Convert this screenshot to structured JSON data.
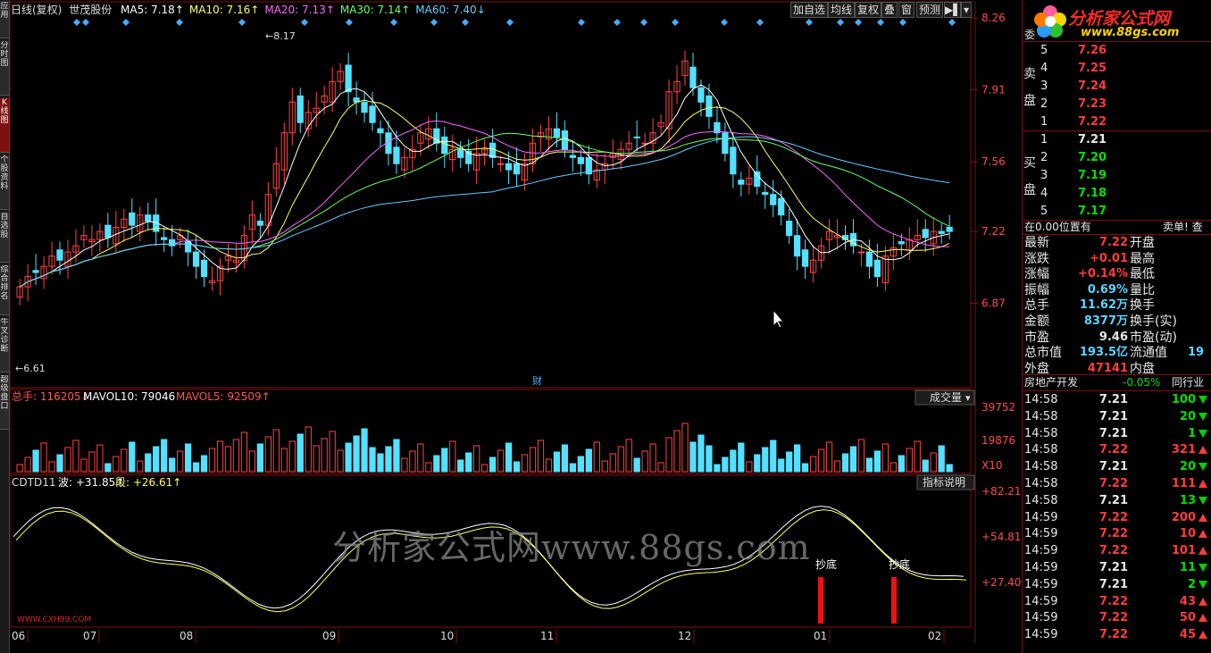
{
  "left_tabs": [
    "应用",
    "分时图",
    "K线图",
    "个股资料",
    "自选股",
    "综合排名",
    "牛叉诊断",
    "超级盘口"
  ],
  "header": {
    "period": "日线(复权)",
    "stock": "世茂股份",
    "ma": [
      {
        "label": "MA5: 7.18",
        "color": "#ffffff"
      },
      {
        "label": "MA10: 7.16",
        "color": "#ffff66"
      },
      {
        "label": "MA20: 7.13",
        "color": "#ff66ff"
      },
      {
        "label": "MA30: 7.14",
        "color": "#66ff66"
      },
      {
        "label": "MA60: 7.40",
        "color": "#66ccff"
      }
    ]
  },
  "toolbar": [
    "加自选",
    "均线",
    "复权",
    "叠",
    "窗",
    "预测"
  ],
  "price_axis": [
    "8.26",
    "7.91",
    "7.56",
    "7.22",
    "6.87"
  ],
  "high_label": "8.17",
  "low_label": "6.61",
  "cai_marker": "财",
  "volume": {
    "title": "总手: 116205",
    "mavol10": "MAVOL10: 79046",
    "mavol5": "MAVOL5: 92509",
    "selector": "成交量",
    "axis": [
      "39752",
      "19876",
      "X10"
    ]
  },
  "indicator": {
    "name": "CDTD11",
    "bo": "波: +31.85",
    "duan": "段: +26.61",
    "btn": "指标说明",
    "axis": [
      "+82.21",
      "+54.81",
      "+27.40"
    ],
    "signals": [
      "抄底",
      "抄底"
    ],
    "site": "WWW.CXH99.COM"
  },
  "months": [
    "06",
    "07",
    "08",
    "09",
    "10",
    "11",
    "12",
    "01",
    "02"
  ],
  "watermark": "分析家公式网www.88gs.com",
  "logo": {
    "name": "分析家公式网",
    "url": "www.88gs.com"
  },
  "orderbook": {
    "sell_label": [
      "卖",
      "盘"
    ],
    "buy_label": [
      "买",
      "盘"
    ],
    "corner": "委",
    "sell": [
      {
        "lvl": "5",
        "price": "7.26"
      },
      {
        "lvl": "4",
        "price": "7.25"
      },
      {
        "lvl": "3",
        "price": "7.24"
      },
      {
        "lvl": "2",
        "price": "7.23"
      },
      {
        "lvl": "1",
        "price": "7.22"
      }
    ],
    "buy": [
      {
        "lvl": "1",
        "price": "7.21"
      },
      {
        "lvl": "2",
        "price": "7.20"
      },
      {
        "lvl": "3",
        "price": "7.19"
      },
      {
        "lvl": "4",
        "price": "7.18"
      },
      {
        "lvl": "5",
        "price": "7.17"
      }
    ]
  },
  "pos_text": "在0.00位置有",
  "pos_link": "卖单! 查",
  "quote": [
    {
      "l": "最新",
      "v": "7.22",
      "vc": "red",
      "r": "开盘",
      "rv": ""
    },
    {
      "l": "涨跌",
      "v": "+0.01",
      "vc": "red",
      "r": "最高",
      "rv": ""
    },
    {
      "l": "涨幅",
      "v": "+0.14%",
      "vc": "red",
      "r": "最低",
      "rv": ""
    },
    {
      "l": "振幅",
      "v": "0.69%",
      "vc": "cyan",
      "r": "量比",
      "rv": ""
    },
    {
      "l": "总手",
      "v": "11.62万",
      "vc": "cyan",
      "r": "换手",
      "rv": ""
    },
    {
      "l": "金额",
      "v": "8377万",
      "vc": "cyan",
      "r": "换手(实)",
      "rv": ""
    },
    {
      "l": "市盈",
      "v": "9.46",
      "vc": "wht",
      "r": "市盈(动)",
      "rv": ""
    },
    {
      "l": "总市值",
      "v": "193.5亿",
      "vc": "cyan",
      "r": "流通值",
      "rv": "19"
    },
    {
      "l": "外盘",
      "v": "47141",
      "vc": "red",
      "r": "内盘",
      "rv": ""
    }
  ],
  "sector": {
    "name": "房地产开发",
    "chg": "-0.05%",
    "peers": "同行业"
  },
  "ticks": [
    {
      "t": "14:58",
      "p": "7.21",
      "pc": "wht",
      "v": "100",
      "d": "dn"
    },
    {
      "t": "14:58",
      "p": "7.21",
      "pc": "wht",
      "v": "20",
      "d": "dn"
    },
    {
      "t": "14:58",
      "p": "7.21",
      "pc": "wht",
      "v": "1",
      "d": "dn"
    },
    {
      "t": "14:58",
      "p": "7.22",
      "pc": "red",
      "v": "321",
      "d": "up"
    },
    {
      "t": "14:58",
      "p": "7.21",
      "pc": "wht",
      "v": "20",
      "d": "dn"
    },
    {
      "t": "14:58",
      "p": "7.22",
      "pc": "red",
      "v": "111",
      "d": "up"
    },
    {
      "t": "14:58",
      "p": "7.21",
      "pc": "wht",
      "v": "13",
      "d": "dn"
    },
    {
      "t": "14:59",
      "p": "7.22",
      "pc": "red",
      "v": "200",
      "d": "up"
    },
    {
      "t": "14:59",
      "p": "7.22",
      "pc": "red",
      "v": "10",
      "d": "up"
    },
    {
      "t": "14:59",
      "p": "7.22",
      "pc": "red",
      "v": "101",
      "d": "up"
    },
    {
      "t": "14:59",
      "p": "7.21",
      "pc": "wht",
      "v": "11",
      "d": "dn"
    },
    {
      "t": "14:59",
      "p": "7.21",
      "pc": "wht",
      "v": "2",
      "d": "dn"
    },
    {
      "t": "14:59",
      "p": "7.22",
      "pc": "red",
      "v": "43",
      "d": "up"
    },
    {
      "t": "14:59",
      "p": "7.22",
      "pc": "red",
      "v": "50",
      "d": "up"
    },
    {
      "t": "14:59",
      "p": "7.22",
      "pc": "red",
      "v": "45",
      "d": "up"
    }
  ],
  "chart_data": {
    "type": "candlestick",
    "price_range": [
      6.52,
      8.26
    ],
    "months": [
      "06",
      "07",
      "08",
      "09",
      "10",
      "11",
      "12",
      "01",
      "02"
    ],
    "closes": [
      6.95,
      7.0,
      7.02,
      7.05,
      7.1,
      7.08,
      7.12,
      7.15,
      7.2,
      7.18,
      7.22,
      7.19,
      7.24,
      7.28,
      7.25,
      7.3,
      7.27,
      7.22,
      7.18,
      7.15,
      7.2,
      7.12,
      7.05,
      7.0,
      6.98,
      7.05,
      7.1,
      7.08,
      7.2,
      7.3,
      7.25,
      7.4,
      7.55,
      7.7,
      7.85,
      7.75,
      7.8,
      7.82,
      7.88,
      7.95,
      8.0,
      7.9,
      7.85,
      7.8,
      7.75,
      7.7,
      7.6,
      7.55,
      7.58,
      7.62,
      7.7,
      7.72,
      7.65,
      7.6,
      7.62,
      7.58,
      7.55,
      7.6,
      7.62,
      7.58,
      7.55,
      7.52,
      7.5,
      7.55,
      7.65,
      7.7,
      7.72,
      7.68,
      7.62,
      7.58,
      7.55,
      7.5,
      7.52,
      7.55,
      7.6,
      7.62,
      7.65,
      7.68,
      7.65,
      7.7,
      7.75,
      7.9,
      7.95,
      8.05,
      7.92,
      7.85,
      7.78,
      7.7,
      7.6,
      7.5,
      7.45,
      7.48,
      7.44,
      7.4,
      7.35,
      7.3,
      7.2,
      7.1,
      7.05,
      7.08,
      7.15,
      7.22,
      7.2,
      7.18,
      7.15,
      7.12,
      7.05,
      7.0,
      7.1,
      7.14,
      7.16,
      7.18,
      7.2,
      7.19,
      7.22,
      7.21,
      7.22
    ],
    "ma60_end": 7.4,
    "indicator_range": [
      0,
      100
    ]
  }
}
